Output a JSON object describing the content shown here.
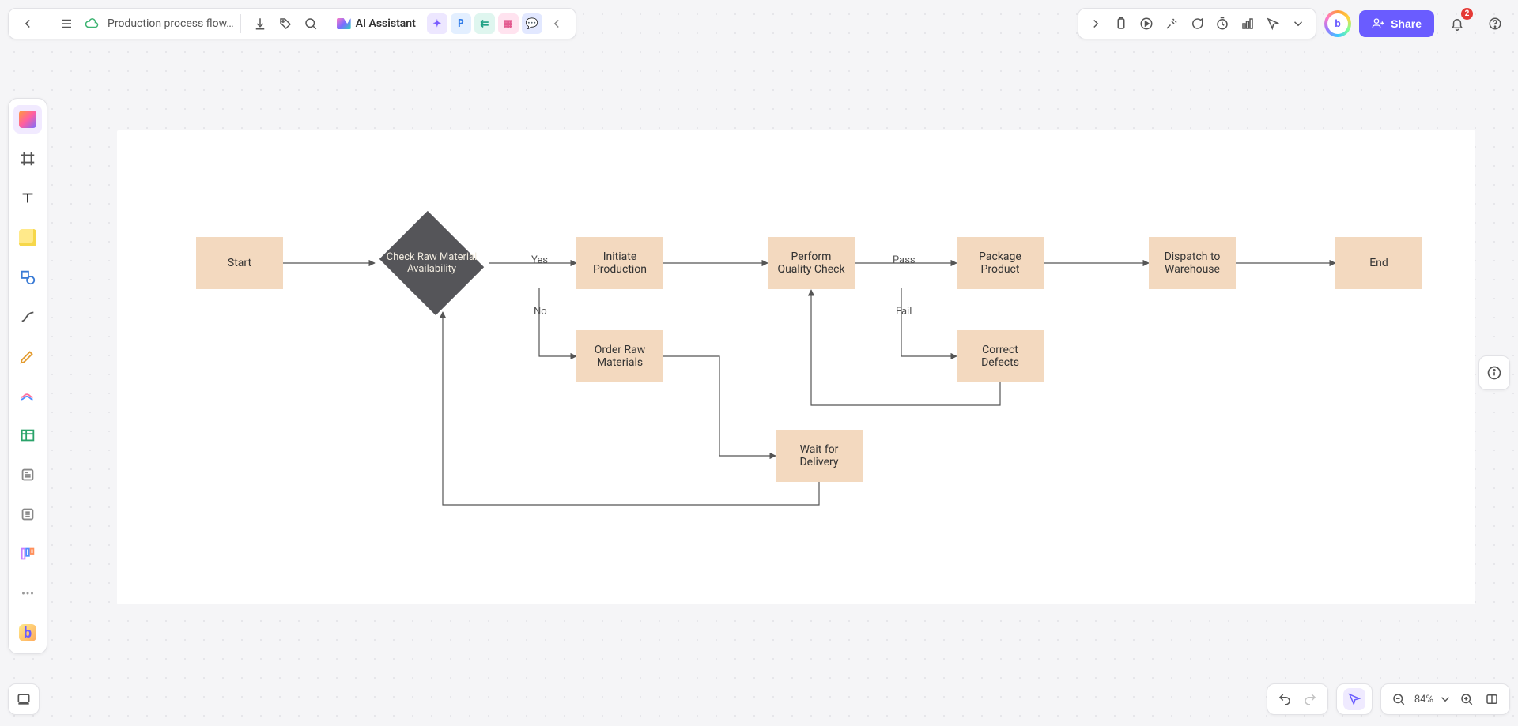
{
  "header": {
    "doc_title": "Production process flow…",
    "ai_assistant": "AI Assistant",
    "share_label": "Share",
    "notification_count": "2",
    "avatar_initial": "b"
  },
  "zoom": {
    "level": "84%"
  },
  "diagram": {
    "type": "flowchart",
    "nodes": {
      "start": {
        "label": "Start"
      },
      "check": {
        "label": "Check Raw Material Availability"
      },
      "initiate": {
        "label": "Initiate Production"
      },
      "perform": {
        "label": "Perform Quality Check"
      },
      "package": {
        "label": "Package Product"
      },
      "dispatch": {
        "label": "Dispatch to Warehouse"
      },
      "end": {
        "label": "End"
      },
      "order": {
        "label": "Order Raw Materials"
      },
      "correct": {
        "label": "Correct Defects"
      },
      "wait": {
        "label": "Wait for Delivery"
      }
    },
    "edges": {
      "yes": {
        "label": "Yes"
      },
      "no": {
        "label": "No"
      },
      "pass": {
        "label": "Pass"
      },
      "fail": {
        "label": "Fail"
      }
    }
  },
  "chart_data": {
    "type": "flowchart",
    "title": "Production process flowchart",
    "nodes": [
      {
        "id": "start",
        "type": "process",
        "label": "Start"
      },
      {
        "id": "check",
        "type": "decision",
        "label": "Check Raw Material Availability"
      },
      {
        "id": "initiate",
        "type": "process",
        "label": "Initiate Production"
      },
      {
        "id": "perform",
        "type": "process",
        "label": "Perform Quality Check"
      },
      {
        "id": "package",
        "type": "process",
        "label": "Package Product"
      },
      {
        "id": "dispatch",
        "type": "process",
        "label": "Dispatch to Warehouse"
      },
      {
        "id": "end",
        "type": "process",
        "label": "End"
      },
      {
        "id": "order",
        "type": "process",
        "label": "Order Raw Materials"
      },
      {
        "id": "wait",
        "type": "process",
        "label": "Wait for Delivery"
      },
      {
        "id": "correct",
        "type": "process",
        "label": "Correct Defects"
      }
    ],
    "edges": [
      {
        "from": "start",
        "to": "check",
        "label": ""
      },
      {
        "from": "check",
        "to": "initiate",
        "label": "Yes"
      },
      {
        "from": "check",
        "to": "order",
        "label": "No"
      },
      {
        "from": "initiate",
        "to": "perform",
        "label": ""
      },
      {
        "from": "perform",
        "to": "package",
        "label": "Pass"
      },
      {
        "from": "perform",
        "to": "correct",
        "label": "Fail"
      },
      {
        "from": "package",
        "to": "dispatch",
        "label": ""
      },
      {
        "from": "dispatch",
        "to": "end",
        "label": ""
      },
      {
        "from": "order",
        "to": "wait",
        "label": ""
      },
      {
        "from": "wait",
        "to": "check",
        "label": ""
      },
      {
        "from": "correct",
        "to": "perform",
        "label": ""
      }
    ],
    "styles": {
      "process_fill": "#f3d9bf",
      "decision_fill": "#555559",
      "arrow_color": "#555555"
    }
  }
}
